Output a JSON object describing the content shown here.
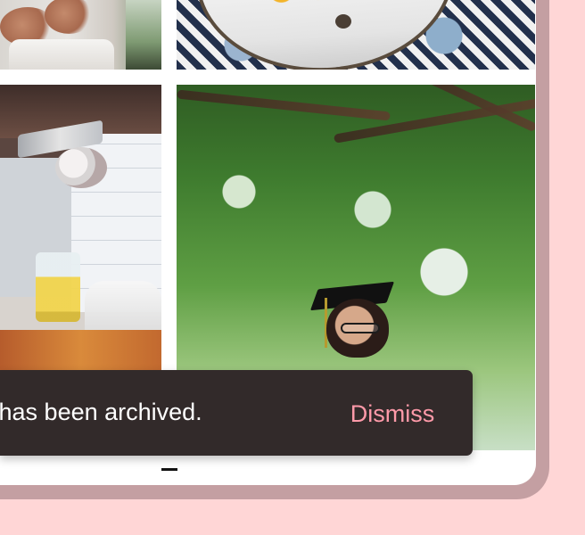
{
  "snackbar": {
    "message": "o has been archived.",
    "action_label": "Dismiss",
    "message_color": "#FFFFFF",
    "action_color": "#FF9AA9",
    "background_color": "#322A2A"
  },
  "gallery": {
    "tiles": [
      {
        "id": "tile-1"
      },
      {
        "id": "tile-2"
      },
      {
        "id": "tile-3"
      },
      {
        "id": "tile-4"
      }
    ]
  },
  "theme": {
    "page_background": "#FFD6D6",
    "frame_color": "#C49FA2",
    "surface_color": "#FFFFFF"
  }
}
